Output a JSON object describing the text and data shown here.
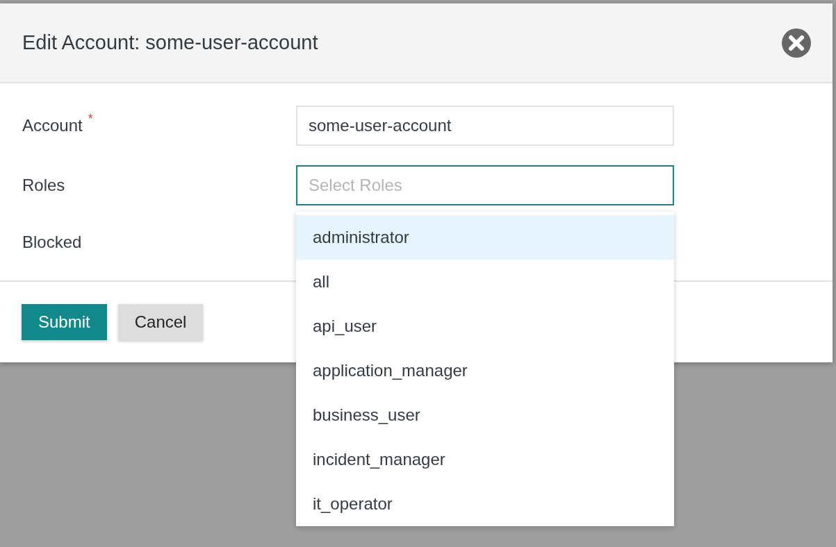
{
  "dialog": {
    "title": "Edit Account: some-user-account"
  },
  "fields": [
    {
      "label": "Account",
      "required_mark": "*",
      "value": "some-user-account",
      "focused": false
    },
    {
      "label": "Roles",
      "placeholder": "Select Roles",
      "focused": true
    },
    {
      "label": "Blocked"
    }
  ],
  "buttons": [
    {
      "label": "Submit",
      "kind": "primary"
    },
    {
      "label": "Cancel",
      "kind": "secondary"
    }
  ],
  "roles_dropdown": [
    {
      "label": "administrator",
      "selected": true
    },
    {
      "label": "all",
      "selected": false
    },
    {
      "label": "api_user",
      "selected": false
    },
    {
      "label": "application_manager",
      "selected": false
    },
    {
      "label": "business_user",
      "selected": false
    },
    {
      "label": "incident_manager",
      "selected": false
    },
    {
      "label": "it_operator",
      "selected": false
    }
  ]
}
